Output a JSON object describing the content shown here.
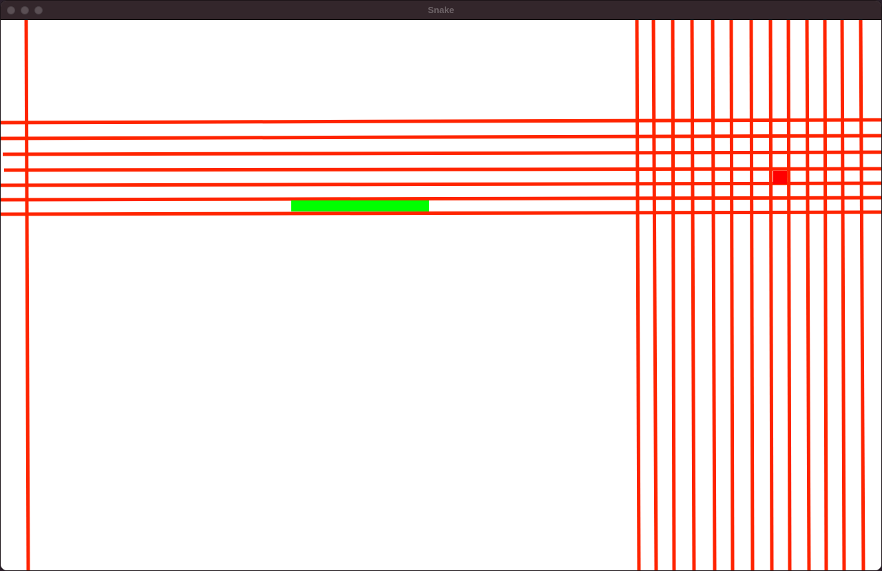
{
  "window": {
    "title": "Snake",
    "controls": {
      "close": "close-button",
      "minimize": "minimize-button",
      "maximize": "maximize-button"
    }
  },
  "colors": {
    "titlebar": "#33262b",
    "board": "#ffffff",
    "line": "#ff2400",
    "snake": "#00ff00",
    "food": "#ff0000"
  },
  "game": {
    "snake_color_name": "green",
    "food_color_name": "red"
  }
}
